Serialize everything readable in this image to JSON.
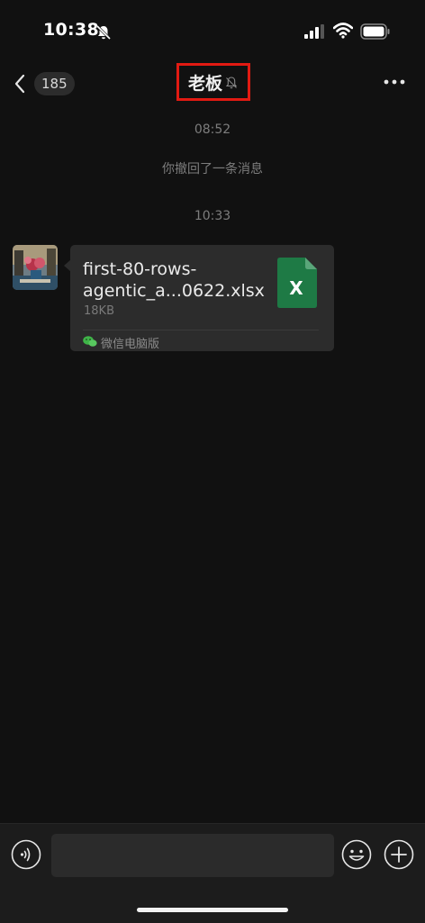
{
  "status_bar": {
    "time": "10:38"
  },
  "nav": {
    "back_count": "185",
    "title": "老板"
  },
  "messages": {
    "timestamp_1": "08:52",
    "recall_notice": "你撤回了一条消息",
    "timestamp_2": "10:33",
    "file": {
      "name": "first-80-rows-agentic_a...0622.xlsx",
      "size": "18KB",
      "source": "微信电脑版",
      "icon_letter": "X",
      "icon_color": "#1e7a45"
    }
  },
  "colors": {
    "background": "#111111",
    "bubble": "#2c2c2c",
    "highlight_box": "#e21a12"
  }
}
